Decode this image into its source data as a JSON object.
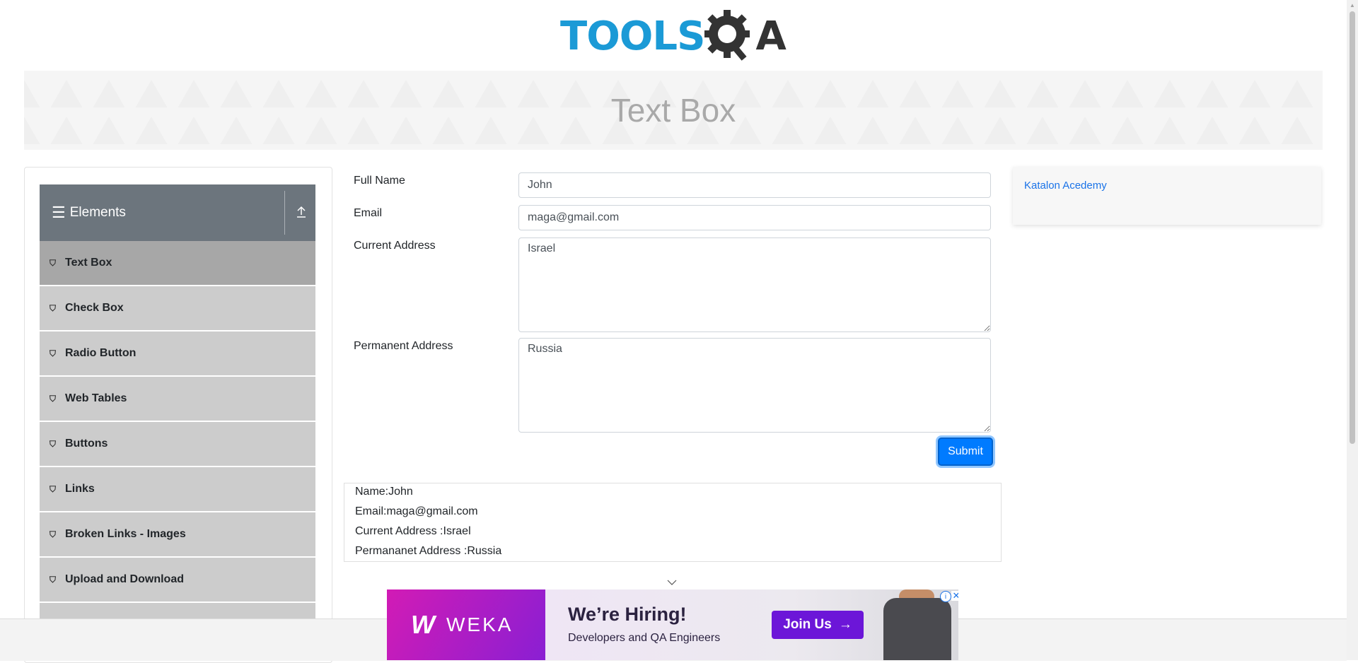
{
  "header": {
    "logo_tools": "TOOLS",
    "logo_qa": "A"
  },
  "banner": {
    "title": "Text Box"
  },
  "sidebar": {
    "group_label": "Elements",
    "items": [
      {
        "label": "Text Box",
        "active": true
      },
      {
        "label": "Check Box"
      },
      {
        "label": "Radio Button"
      },
      {
        "label": "Web Tables"
      },
      {
        "label": "Buttons"
      },
      {
        "label": "Links"
      },
      {
        "label": "Broken Links - Images"
      },
      {
        "label": "Upload and Download"
      }
    ]
  },
  "form": {
    "full_name": {
      "label": "Full Name",
      "value": "John"
    },
    "email": {
      "label": "Email",
      "value": "maga@gmail.com"
    },
    "current_address": {
      "label": "Current Address",
      "value": "Israel"
    },
    "permanent_address": {
      "label": "Permanent Address",
      "value": "Russia"
    },
    "submit_label": "Submit"
  },
  "output": {
    "name": "Name:John",
    "email": "Email:maga@gmail.com",
    "current_address": "Current Address :Israel",
    "permanent_address": "Permananet Address :Russia"
  },
  "right_ad": {
    "alt_text": "Katalon Acedemy"
  },
  "bottom_ad": {
    "brand": "WEKA",
    "headline": "We’re Hiring!",
    "subline": "Developers and QA Engineers",
    "cta": "Join Us"
  },
  "colors": {
    "primary": "#007bff",
    "sidebar_header": "#6c757d",
    "menu_item": "#cccccc",
    "menu_item_active": "#a7a7a7",
    "logo_blue": "#1b9ad6"
  }
}
